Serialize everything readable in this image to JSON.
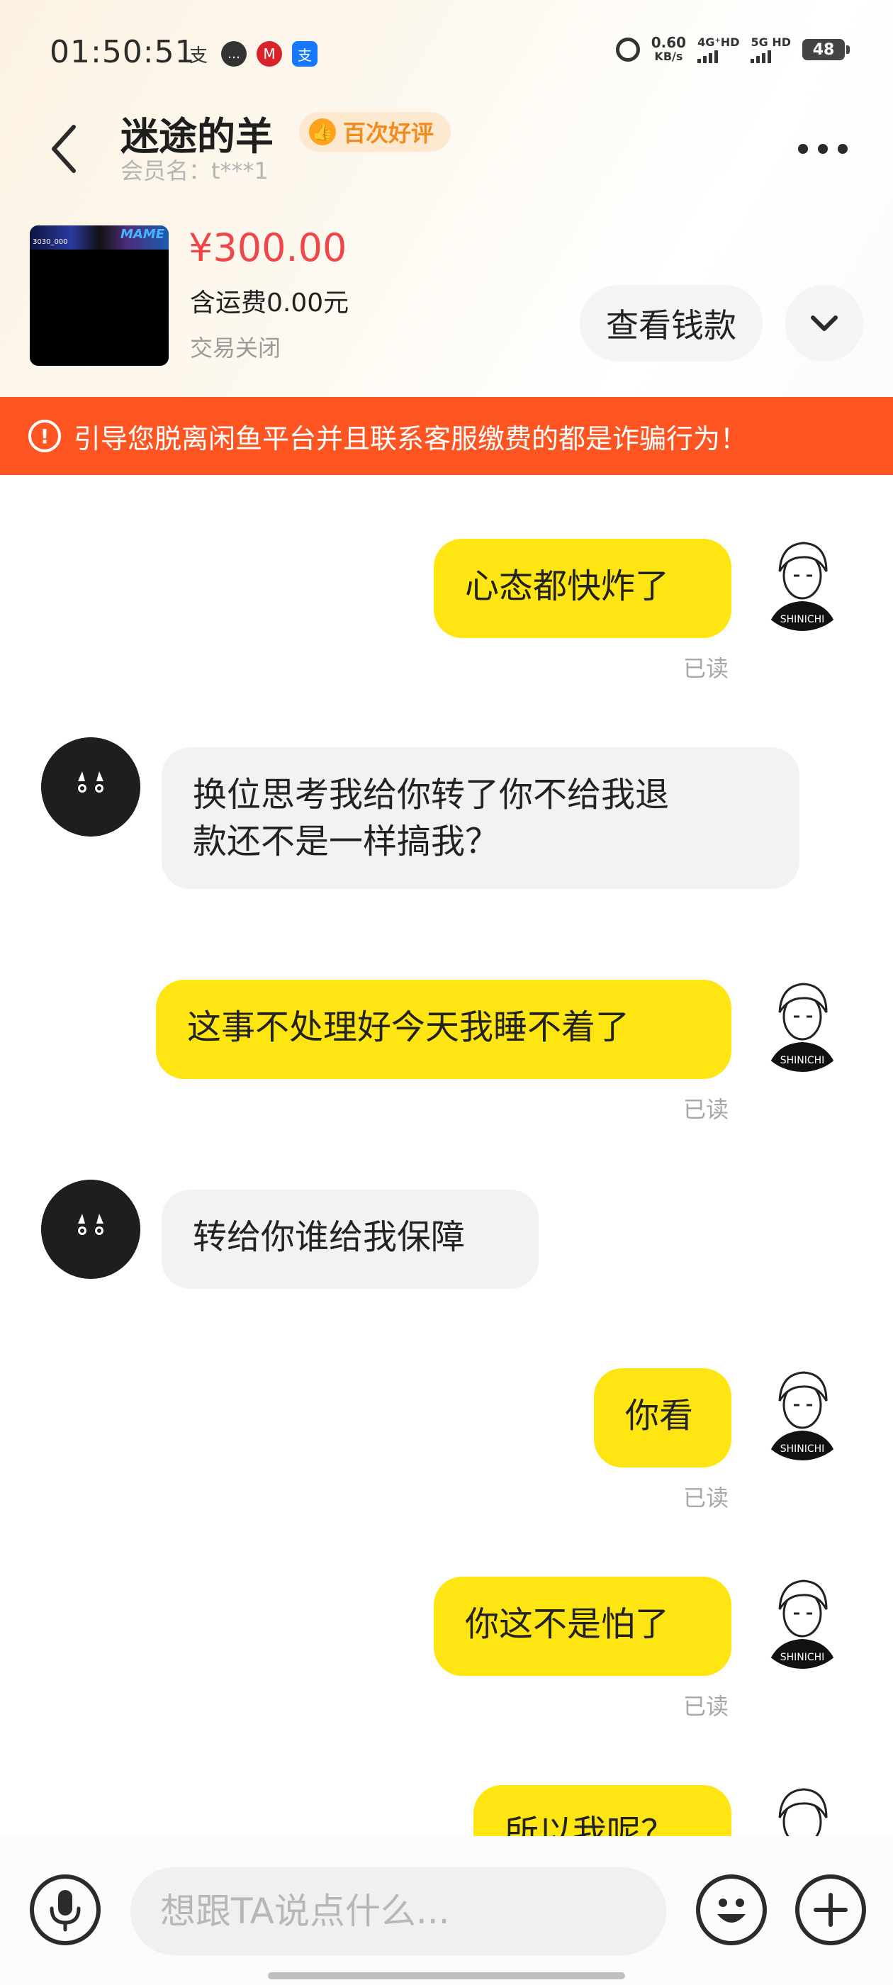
{
  "status_bar": {
    "time": "01:50:51",
    "left_icons": [
      "alipay-text-icon",
      "chat-bubble-icon",
      "bank-icon",
      "alipay-app-icon"
    ],
    "speed_value": "0.60",
    "speed_unit": "KB/s",
    "net1": "4G⁺HD",
    "net2": "5G HD",
    "battery": "48"
  },
  "header": {
    "seller_name": "迷途的羊",
    "badge": "百次好评",
    "member_label": "会员名：t***1"
  },
  "product": {
    "price": "¥300.00",
    "shipping": "含运费0.00元",
    "status": "交易关闭",
    "view_button": "查看钱款",
    "thumb_brand": "MAME",
    "thumb_code": "3030_000"
  },
  "warning": {
    "text": "引导您脱离闲鱼平台并且联系客服缴费的都是诈骗行为！"
  },
  "messages": [
    {
      "from": "me",
      "text": "心态都快炸了",
      "read": "已读"
    },
    {
      "from": "them",
      "line1": "换位思考我给你转了你不给我退",
      "line2": "款还不是一样搞我？"
    },
    {
      "from": "me",
      "text": "这事不处理好今天我睡不着了",
      "read": "已读"
    },
    {
      "from": "them",
      "text": "转给你谁给我保障"
    },
    {
      "from": "me",
      "text": "你看",
      "read": "已读"
    },
    {
      "from": "me",
      "text": "你这不是怕了",
      "read": "已读"
    },
    {
      "from": "me",
      "text": "所以我呢？"
    }
  ],
  "input": {
    "placeholder": "想跟TA说点什么..."
  },
  "colors": {
    "my_bubble": "#ffe512",
    "their_bubble": "#f2f2f4",
    "price": "#f0464a",
    "warning_bg": "#fe5522",
    "badge_text": "#f28a1d"
  }
}
